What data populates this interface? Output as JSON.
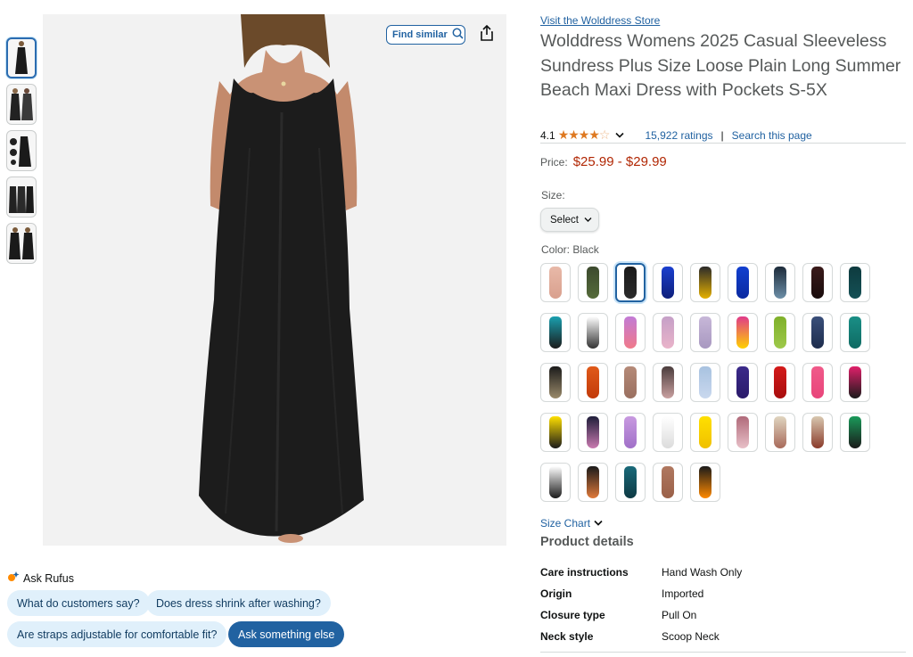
{
  "thumbnails": [
    {
      "alt": "black dress front"
    },
    {
      "alt": "two models"
    },
    {
      "alt": "dress details"
    },
    {
      "alt": "three models"
    },
    {
      "alt": "dress front and back"
    }
  ],
  "image_actions": {
    "find_similar_label": "Find similar"
  },
  "rufus": {
    "title": "Ask Rufus",
    "chips": [
      "What do customers say?",
      "Does dress shrink after washing?",
      "Are straps adjustable for comfortable fit?",
      "Ask something else"
    ]
  },
  "product": {
    "store_link": "Visit the Wolddress Store",
    "title": "Wolddress Womens 2025 Casual Sleeveless Sundress Plus Size Loose Plain Long Summer Beach Maxi Dress with Pockets S-5X",
    "rating_value": "4.1",
    "rating_stars": 4.1,
    "ratings_count": "15,922 ratings",
    "search_page": "Search this page",
    "price_label": "Price:",
    "price_range": "$25.99 - $29.99",
    "size_label": "Size:",
    "size_select": "Select",
    "color_label": "Color: Black",
    "size_chart": "Size Chart",
    "details_heading": "Product details",
    "details": [
      {
        "key": "Care instructions",
        "value": "Hand Wash Only"
      },
      {
        "key": "Origin",
        "value": "Imported"
      },
      {
        "key": "Closure type",
        "value": "Pull On"
      },
      {
        "key": "Neck style",
        "value": "Scoop Neck"
      }
    ]
  },
  "colors": {
    "accent_link": "#2162a1",
    "price": "#b12704",
    "star": "#de7921",
    "chip_bg": "#e0f0fb",
    "chip_dark_bg": "#2162a1"
  },
  "swatches": [
    "linear-gradient(#e8b9a8,#d9a08e)",
    "linear-gradient(#3c4a2e,#556b3a)",
    "linear-gradient(#1a1a1a,#2b2b2b)",
    "linear-gradient(#1b3fcf,#0e1f7a)",
    "linear-gradient(#2a2a2a,#e5b000)",
    "linear-gradient(#1240d0,#0a2aa0)",
    "linear-gradient(#1d2b3a,#6d8fa8)",
    "linear-gradient(#3a1a1a,#1a0d0d)",
    "linear-gradient(#0e3b3f,#145055)",
    "linear-gradient(#1aa0b0,#1b1b1b)",
    "linear-gradient(#ffffff,#333333)",
    "linear-gradient(#c27bd6,#f07a8a)",
    "linear-gradient(#c5a0c8,#e9b3c9)",
    "linear-gradient(#c7b7d8,#a898c0)",
    "linear-gradient(#e03a8a,#ffd100)",
    "linear-gradient(#7fb02a,#9ec94a)",
    "linear-gradient(#3a4f7a,#1e2d4d)",
    "linear-gradient(#1a8f86,#0e6a63)",
    "linear-gradient(#1b1b1b,#9a8a6a)",
    "linear-gradient(#e05a1a,#c23a0a)",
    "linear-gradient(#b58a78,#9a7060)",
    "linear-gradient(#4b3d3d,#c9a0a0)",
    "linear-gradient(#a8c2e0,#c9d8ee)",
    "linear-gradient(#3b2a8a,#2a1a6a)",
    "linear-gradient(#d41a1a,#a80e0e)",
    "linear-gradient(#f05a8a,#e8457a)",
    "linear-gradient(#e0206a,#1a1a1a)",
    "linear-gradient(#ffe000,#1a1a1a)",
    "linear-gradient(#1e1e3a,#c97ab0)",
    "linear-gradient(#c89ae0,#a070c8)",
    "linear-gradient(#ffffff,#dcdcdc)",
    "linear-gradient(#ffe000,#f0c000)",
    "linear-gradient(#b06a7a,#e8c0c8)",
    "linear-gradient(#e0d5c0,#a86a5a)",
    "linear-gradient(#d8c8b0,#8a3a2a)",
    "linear-gradient(#1a9a5a,#1a1a1a)",
    "linear-gradient(#ffffff,#1a1a1a)",
    "linear-gradient(#1a1a1a,#e07a3a)",
    "linear-gradient(#1a6a7a,#0e3a44)",
    "linear-gradient(#b07860,#9a6048)",
    "linear-gradient(#1a1a1a,#ff8a00)"
  ],
  "selected_swatch_index": 2
}
